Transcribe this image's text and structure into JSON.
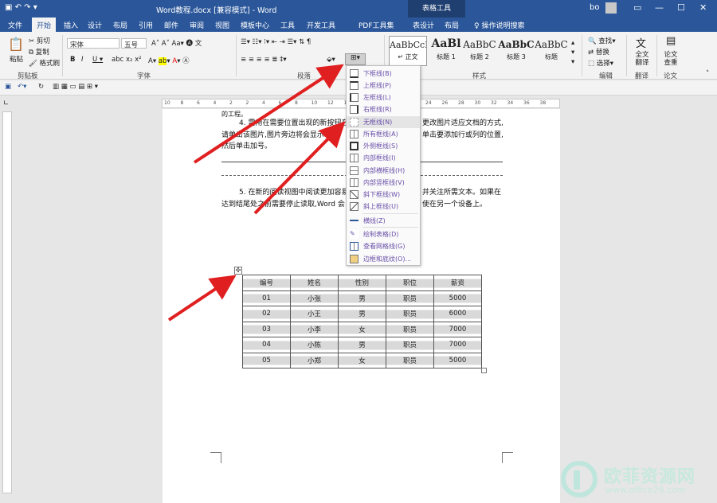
{
  "window": {
    "title": "Word教程.docx [兼容模式] - Word",
    "table_tools": "表格工具",
    "user": "bo"
  },
  "tabs": [
    "文件",
    "开始",
    "插入",
    "设计",
    "布局",
    "引用",
    "邮件",
    "审阅",
    "视图",
    "模板中心",
    "工具",
    "开发工具",
    "PDF工具集",
    "表设计",
    "布局"
  ],
  "tell_me": "操作说明搜索",
  "ribbon": {
    "clipboard": {
      "paste": "粘贴",
      "cut": "剪切",
      "copy": "复制",
      "format_painter": "格式刷",
      "label": "剪贴板"
    },
    "font": {
      "name": "宋体",
      "size": "五号",
      "label": "字体"
    },
    "paragraph": {
      "label": "段落"
    },
    "styles": {
      "label": "样式",
      "items": [
        {
          "sample": "AaBbCcI",
          "name": "↵ 正文"
        },
        {
          "sample": "AaBl",
          "name": "标题 1"
        },
        {
          "sample": "AaBbC",
          "name": "标题 2"
        },
        {
          "sample": "AaBbC",
          "name": "标题 3"
        },
        {
          "sample": "AaBbC",
          "name": "标题"
        }
      ]
    },
    "editing": {
      "find": "查找",
      "replace": "替换",
      "select": "选择",
      "label": "编辑"
    },
    "translate": {
      "btn": "全文翻译",
      "label": "翻译"
    },
    "paper": {
      "btn": "论文查重",
      "label": "论文"
    }
  },
  "ruler_ticks": [
    "10",
    "8",
    "6",
    "4",
    "2",
    "2",
    "4",
    "6",
    "8",
    "10",
    "12",
    "14",
    "16",
    "18",
    "20",
    "22",
    "24",
    "26",
    "28",
    "30",
    "32",
    "34",
    "36",
    "38"
  ],
  "document": {
    "partial_top": "的工程。",
    "para4_line1": "4. 需用在需要位置出现的新按钮在",
    "para4_line1b": "更改图片适应文档的方式,",
    "para4_line2": "请单击该图片,图片旁边将会显示布",
    "para4_line2b": "单击要添加行或列的位置,",
    "para4_line3": "然后单击加号。",
    "para5_line1": "5. 在新的阅读视图中阅读更加容易",
    "para5_line1b": "并关注所需文本。如果在",
    "para5_line2": "达到结尾处之前需要停止读取,Word 会",
    "para5_line2b": "使在另一个设备上。"
  },
  "table": {
    "headers": [
      "编号",
      "姓名",
      "性别",
      "职位",
      "薪资"
    ],
    "rows": [
      [
        "01",
        "小张",
        "男",
        "职员",
        "5000"
      ],
      [
        "02",
        "小王",
        "男",
        "职员",
        "6000"
      ],
      [
        "03",
        "小李",
        "女",
        "职员",
        "7000"
      ],
      [
        "04",
        "小陈",
        "男",
        "职员",
        "7000"
      ],
      [
        "05",
        "小郑",
        "女",
        "职员",
        "5000"
      ]
    ]
  },
  "borders_menu": [
    "下框线(B)",
    "上框线(P)",
    "左框线(L)",
    "右框线(R)",
    "无框线(N)",
    "所有框线(A)",
    "外侧框线(S)",
    "内部框线(I)",
    "内部横框线(H)",
    "内部竖框线(V)",
    "斜下框线(W)",
    "斜上框线(U)",
    "横线(Z)",
    "绘制表格(D)",
    "查看网格线(G)",
    "边框和底纹(O)..."
  ],
  "watermark": {
    "name": "欧菲资源网",
    "url": "www.office26.com"
  },
  "colors": {
    "word_blue": "#2b579a",
    "arrow_red": "#e02020",
    "menu_text": "#6a4fa8"
  }
}
